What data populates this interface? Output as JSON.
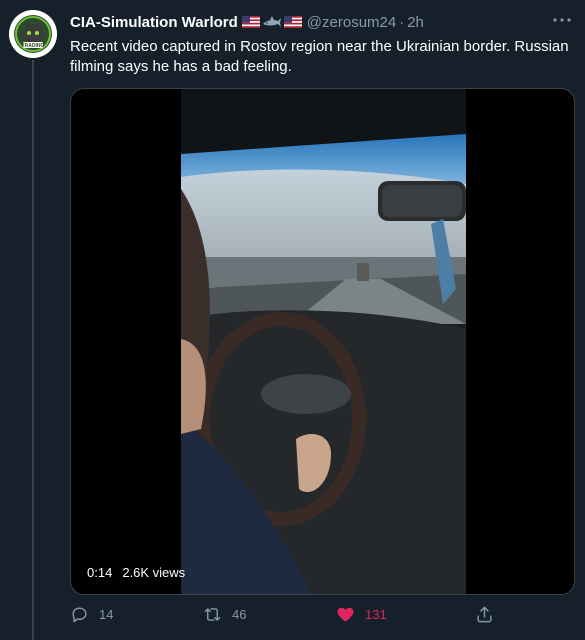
{
  "tweet": {
    "display_name": "CIA-Simulation Warlord",
    "handle": "@zerosum24",
    "separator": "·",
    "time": "2h",
    "text": "Recent video captured in Rostov region near the Ukrainian border. Russian filming says he has a bad feeling.",
    "avatar_text": "TRADING",
    "name_emoji": [
      "us-flag-icon",
      "shark-icon",
      "us-flag-icon"
    ]
  },
  "media": {
    "duration": "0:14",
    "views": "2.6K views"
  },
  "actions": {
    "replies": "14",
    "retweets": "46",
    "likes": "131",
    "liked": true
  },
  "colors": {
    "background": "#15202b",
    "secondary_text": "#8899a6",
    "like_active": "#e0245e",
    "border": "#38444d"
  }
}
